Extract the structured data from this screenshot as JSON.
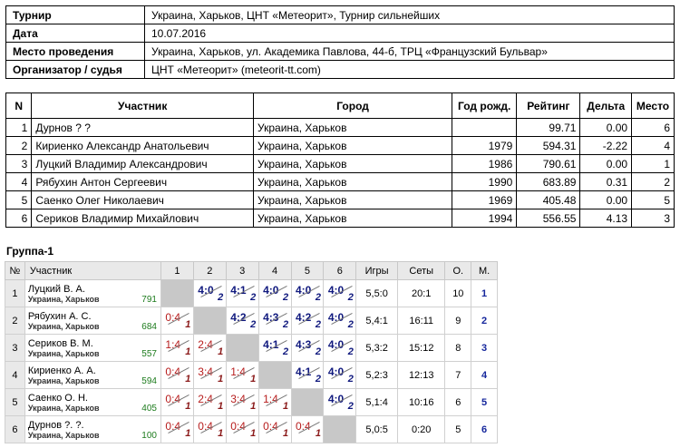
{
  "info": [
    {
      "key": "Турнир",
      "value": "Украина, Харьков, ЦНТ «Метеорит», Турнир сильнейших"
    },
    {
      "key": "Дата",
      "value": "10.07.2016"
    },
    {
      "key": "Место проведения",
      "value": "Украина, Харьков, ул. Академика Павлова, 44-б, ТРЦ «Французский Бульвар»"
    },
    {
      "key": "Организатор / судья",
      "value": "ЦНТ «Метеорит» (meteorit-tt.com)"
    }
  ],
  "participants": {
    "headers": [
      "N",
      "Участник",
      "Город",
      "Год рожд.",
      "Рейтинг",
      "Дельта",
      "Место"
    ],
    "rows": [
      {
        "n": "1",
        "name": "Дурнов ? ?",
        "city": "Украина, Харьков",
        "year": "",
        "rating": "99.71",
        "delta": "0.00",
        "place": "6"
      },
      {
        "n": "2",
        "name": "Кириенко Александр Анатольевич",
        "city": "Украина, Харьков",
        "year": "1979",
        "rating": "594.31",
        "delta": "-2.22",
        "place": "4"
      },
      {
        "n": "3",
        "name": "Луцкий Владимир Александрович",
        "city": "Украина, Харьков",
        "year": "1986",
        "rating": "790.61",
        "delta": "0.00",
        "place": "1"
      },
      {
        "n": "4",
        "name": "Рябухин Антон Сергеевич",
        "city": "Украина, Харьков",
        "year": "1990",
        "rating": "683.89",
        "delta": "0.31",
        "place": "2"
      },
      {
        "n": "5",
        "name": "Саенко Олег Николаевич",
        "city": "Украина, Харьков",
        "year": "1969",
        "rating": "405.48",
        "delta": "0.00",
        "place": "5"
      },
      {
        "n": "6",
        "name": "Сериков Владимир Михайлович",
        "city": "Украина, Харьков",
        "year": "1994",
        "rating": "556.55",
        "delta": "4.13",
        "place": "3"
      }
    ]
  },
  "group": {
    "title": "Группа-1",
    "headers": [
      "№",
      "Участник",
      "1",
      "2",
      "3",
      "4",
      "5",
      "6",
      "Игры",
      "Сеты",
      "О.",
      "М."
    ],
    "rows": [
      {
        "n": "1",
        "name": "Луцкий В. А.",
        "city": "Украина, Харьков",
        "rating": "791",
        "results": [
          null,
          {
            "s": "4:0",
            "p": "2"
          },
          {
            "s": "4:1",
            "p": "2"
          },
          {
            "s": "4:0",
            "p": "2"
          },
          {
            "s": "4:0",
            "p": "2"
          },
          {
            "s": "4:0",
            "p": "2"
          }
        ],
        "games": "5,5:0",
        "sets": "20:1",
        "points": "10",
        "place": "1"
      },
      {
        "n": "2",
        "name": "Рябухин А. С.",
        "city": "Украина, Харьков",
        "rating": "684",
        "results": [
          {
            "s": "0:4",
            "p": "1"
          },
          null,
          {
            "s": "4:2",
            "p": "2"
          },
          {
            "s": "4:3",
            "p": "2"
          },
          {
            "s": "4:2",
            "p": "2"
          },
          {
            "s": "4:0",
            "p": "2"
          }
        ],
        "games": "5,4:1",
        "sets": "16:11",
        "points": "9",
        "place": "2"
      },
      {
        "n": "3",
        "name": "Сериков В. М.",
        "city": "Украина, Харьков",
        "rating": "557",
        "results": [
          {
            "s": "1:4",
            "p": "1"
          },
          {
            "s": "2:4",
            "p": "1"
          },
          null,
          {
            "s": "4:1",
            "p": "2"
          },
          {
            "s": "4:3",
            "p": "2"
          },
          {
            "s": "4:0",
            "p": "2"
          }
        ],
        "games": "5,3:2",
        "sets": "15:12",
        "points": "8",
        "place": "3"
      },
      {
        "n": "4",
        "name": "Кириенко А. А.",
        "city": "Украина, Харьков",
        "rating": "594",
        "results": [
          {
            "s": "0:4",
            "p": "1"
          },
          {
            "s": "3:4",
            "p": "1"
          },
          {
            "s": "1:4",
            "p": "1"
          },
          null,
          {
            "s": "4:1",
            "p": "2"
          },
          {
            "s": "4:0",
            "p": "2"
          }
        ],
        "games": "5,2:3",
        "sets": "12:13",
        "points": "7",
        "place": "4"
      },
      {
        "n": "5",
        "name": "Саенко О. Н.",
        "city": "Украина, Харьков",
        "rating": "405",
        "results": [
          {
            "s": "0:4",
            "p": "1"
          },
          {
            "s": "2:4",
            "p": "1"
          },
          {
            "s": "3:4",
            "p": "1"
          },
          {
            "s": "1:4",
            "p": "1"
          },
          null,
          {
            "s": "4:0",
            "p": "2"
          }
        ],
        "games": "5,1:4",
        "sets": "10:16",
        "points": "6",
        "place": "5"
      },
      {
        "n": "6",
        "name": "Дурнов ?. ?.",
        "city": "Украина, Харьков",
        "rating": "100",
        "results": [
          {
            "s": "0:4",
            "p": "1"
          },
          {
            "s": "0:4",
            "p": "1"
          },
          {
            "s": "0:4",
            "p": "1"
          },
          {
            "s": "0:4",
            "p": "1"
          },
          {
            "s": "0:4",
            "p": "1"
          },
          null
        ],
        "games": "5,0:5",
        "sets": "0:20",
        "points": "5",
        "place": "6"
      }
    ]
  }
}
